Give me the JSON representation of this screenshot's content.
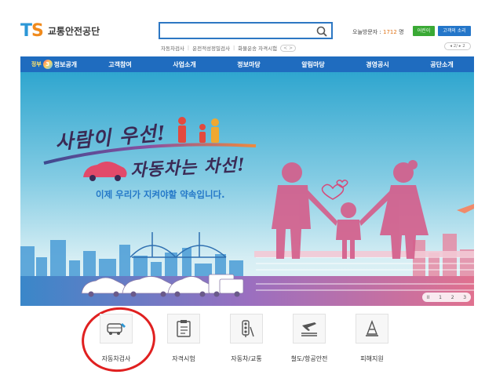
{
  "header": {
    "logo_mark_t": "T",
    "logo_mark_s": "S",
    "logo_name": "교통안전공단",
    "search_placeholder": "",
    "quick_links": [
      "자동차검사",
      "운전적성정밀검사",
      "화물운송 자격시험"
    ],
    "quick_pager": "< >",
    "visitor_label": "오늘방문자 : ",
    "visitor_count": "1712",
    "visitor_unit": " 명",
    "btn_green": "어린이",
    "btn_blue": "고객의 소리",
    "small_pager": "◂ 2/ ▸ 2"
  },
  "nav": {
    "gov_label": "정부",
    "gov_num": "3.0",
    "items": [
      "정보공개",
      "고객참여",
      "사업소개",
      "정보마당",
      "알림마당",
      "경영공시",
      "공단소개"
    ]
  },
  "banner": {
    "slogan_line1": "사람이 우선!",
    "slogan_line2": "자동차는 차선!",
    "slogan_line3": "이제 우리가 지켜야할 약속입니다.",
    "slide_controls": [
      "II",
      "1",
      "2",
      "3"
    ]
  },
  "services": [
    {
      "label": "자동차검사",
      "icon": "car-inspection-icon"
    },
    {
      "label": "자격시험",
      "icon": "clipboard-icon"
    },
    {
      "label": "자동차/교통",
      "icon": "traffic-light-icon"
    },
    {
      "label": "철도/항공안전",
      "icon": "plane-train-icon"
    },
    {
      "label": "피해지원",
      "icon": "cone-icon"
    }
  ],
  "colors": {
    "nav_bg": "#1f6cbf",
    "accent_orange": "#f08a1c",
    "accent_blue": "#2c97d6",
    "highlight_red": "#e02020"
  }
}
